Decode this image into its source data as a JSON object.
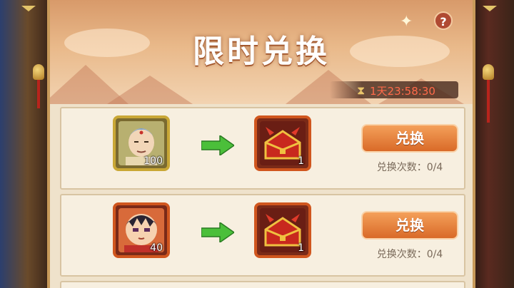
{
  "title": "限时兑换",
  "timer": "1天23:58:30",
  "help_label": "?",
  "rows": [
    {
      "give": {
        "icon": "monk-portrait-icon",
        "count": "100"
      },
      "get": {
        "icon": "red-treasure-chest-icon",
        "count": "1"
      },
      "button_label": "兑换",
      "limit_text": "兑换次数：0/4"
    },
    {
      "give": {
        "icon": "warrior-portrait-icon",
        "count": "40"
      },
      "get": {
        "icon": "red-treasure-chest-icon",
        "count": "1"
      },
      "button_label": "兑换",
      "limit_text": "兑换次数：0/4"
    }
  ],
  "colors": {
    "accent": "#d96a28",
    "timer": "#ff6a4a",
    "panel": "#efe2cb"
  }
}
